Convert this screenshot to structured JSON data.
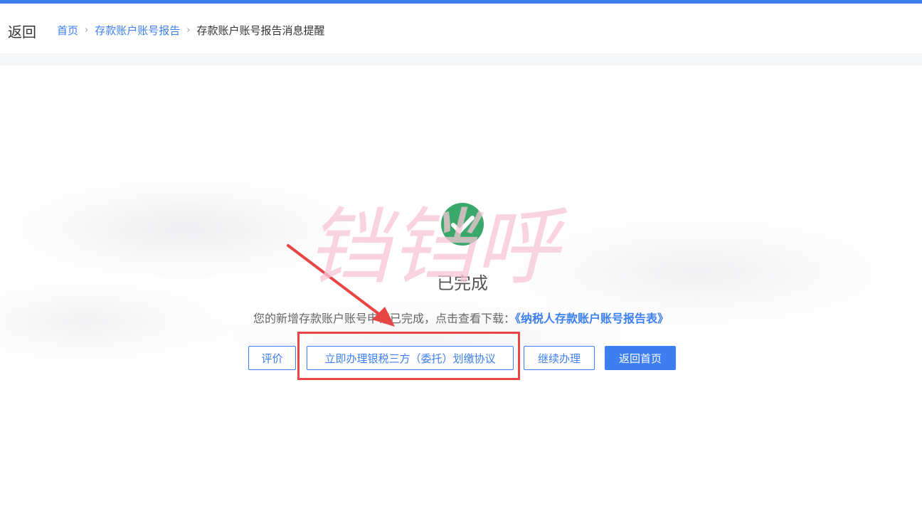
{
  "header": {
    "back_label": "返回",
    "breadcrumb": {
      "home": "首页",
      "parent": "存款账户账号报告",
      "current": "存款账户账号报告消息提醒",
      "separator": "›"
    }
  },
  "result": {
    "icon": "check-circle-icon",
    "status": "已完成",
    "message": "您的新增存款账户账号申请已完成，点击查看下载：",
    "report_link": "《纳税人存款账户账号报告表》"
  },
  "actions": {
    "rate": "评价",
    "tripartite_agreement": "立即办理银税三方（委托）划缴协议",
    "continue": "继续办理",
    "home": "返回首页"
  },
  "watermark": {
    "text": "铛铛呼"
  },
  "colors": {
    "accent": "#3d7ff0",
    "success": "#3aa86b",
    "highlight": "#e84545",
    "watermark": "#f7c6d6"
  }
}
